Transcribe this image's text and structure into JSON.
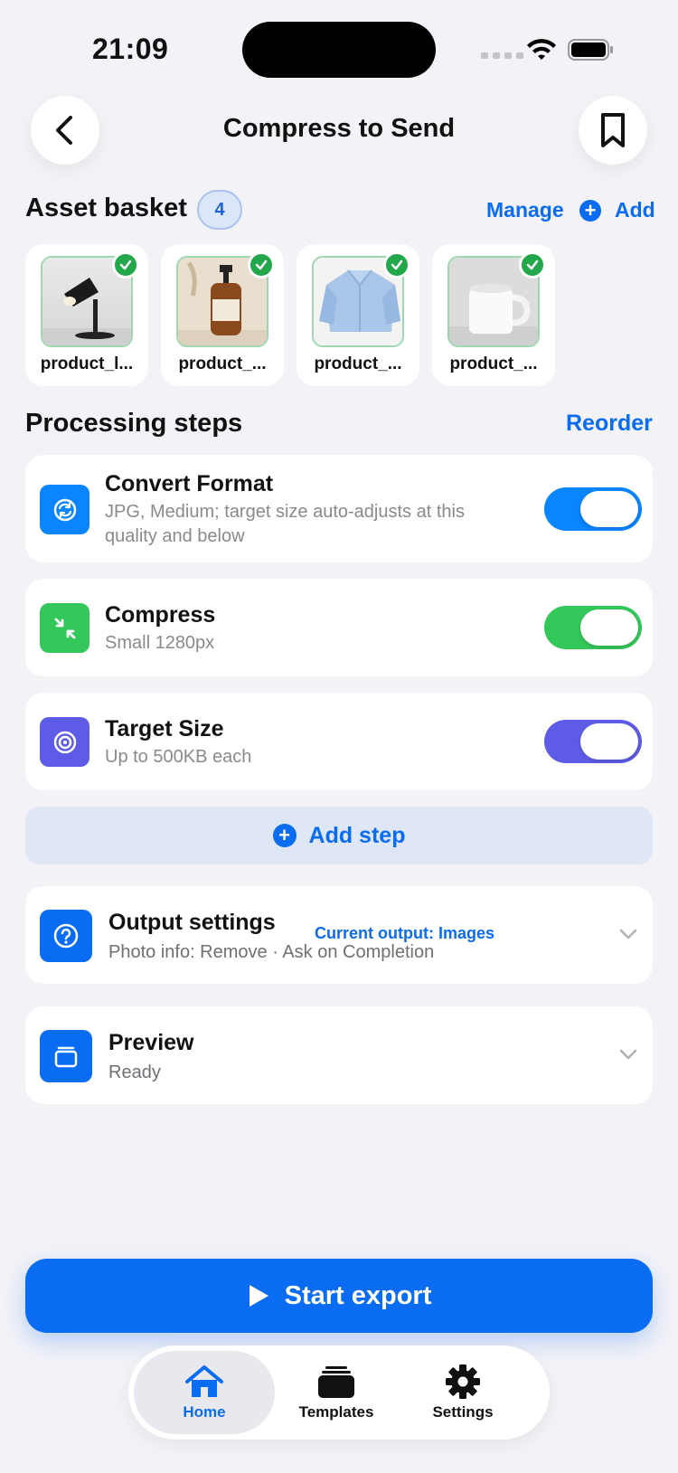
{
  "status_bar": {
    "time": "21:09"
  },
  "nav": {
    "title": "Compress to Send"
  },
  "basket": {
    "title": "Asset basket",
    "count": "4",
    "manage_label": "Manage",
    "add_label": "Add",
    "assets": [
      {
        "name": "product_l...",
        "thumb": "lamp"
      },
      {
        "name": "product_...",
        "thumb": "bottle"
      },
      {
        "name": "product_...",
        "thumb": "shirt"
      },
      {
        "name": "product_...",
        "thumb": "mug"
      }
    ]
  },
  "processing": {
    "title": "Processing steps",
    "reorder_label": "Reorder",
    "steps": [
      {
        "title": "Convert Format",
        "subtitle_line1": "JPG, Medium; target size auto-adjusts at this",
        "subtitle_line2": "quality and below",
        "enabled": true,
        "color": "#0a84ff",
        "icon": "convert-icon"
      },
      {
        "title": "Compress",
        "subtitle": "Small 1280px",
        "enabled": true,
        "color": "#34c759",
        "icon": "compress-icon"
      },
      {
        "title": "Target Size",
        "subtitle": "Up to 500KB each",
        "enabled": true,
        "color": "#5e5ce6",
        "icon": "target-icon"
      }
    ],
    "add_step_label": "Add step"
  },
  "output": {
    "title": "Output settings",
    "tag": "Current output: Images",
    "subtitle": "Photo info: Remove · Ask on Completion"
  },
  "preview": {
    "title": "Preview",
    "subtitle": "Ready"
  },
  "export": {
    "label": "Start export"
  },
  "tabbar": {
    "tabs": [
      {
        "label": "Home",
        "icon": "home-icon",
        "active": true
      },
      {
        "label": "Templates",
        "icon": "templates-icon",
        "active": false
      },
      {
        "label": "Settings",
        "icon": "gear-icon",
        "active": false
      }
    ]
  }
}
